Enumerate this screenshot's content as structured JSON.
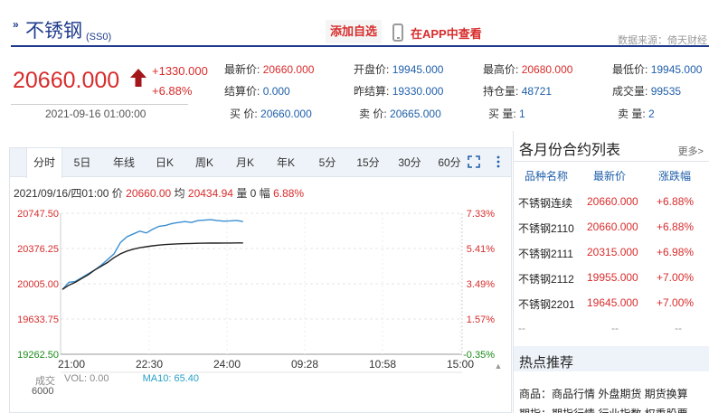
{
  "header": {
    "mark": "»",
    "name": "不锈钢",
    "code": "(SS0)",
    "add_favorite": "添加自选",
    "app_view": "在APP中查看",
    "data_source": "数据来源：倚天财经"
  },
  "quote": {
    "price": "20660.000",
    "change_abs": "+1330.000",
    "change_pct": "+6.88%",
    "time": "2021-09-16 01:00:00",
    "fields": [
      {
        "label": "最新价:",
        "value": "20660.000"
      },
      {
        "label": "开盘价:",
        "value": "19945.000"
      },
      {
        "label": "最高价:",
        "value": "20680.000"
      },
      {
        "label": "最低价:",
        "value": "19945.000"
      },
      {
        "label": "结算价:",
        "value": "0.000"
      },
      {
        "label": "昨结算:",
        "value": "19330.000"
      },
      {
        "label": "持仓量:",
        "value": "48721"
      },
      {
        "label": "成交量:",
        "value": "99535"
      },
      {
        "label": "买  价:",
        "value": "20660.000"
      },
      {
        "label": "卖  价:",
        "value": "20665.000"
      },
      {
        "label": "买  量:",
        "value": "1"
      },
      {
        "label": "卖  量:",
        "value": "2"
      }
    ]
  },
  "tabs": [
    "分时",
    "5日",
    "年线",
    "日K",
    "周K",
    "月K",
    "年K",
    "5分",
    "15分",
    "30分",
    "60分"
  ],
  "info_line": {
    "date": "2021/09/16/四01:00",
    "price_label": "价",
    "price": "20660.00",
    "avg_label": "均",
    "avg": "20434.94",
    "vol_label": "量",
    "vol": "0",
    "amp_label": "幅",
    "amp": "6.88%"
  },
  "chart_data": {
    "type": "line",
    "y_left_ticks": [
      "20747.50",
      "20376.25",
      "20005.00",
      "19633.75",
      "19262.50"
    ],
    "y_right_ticks": [
      "7.33%",
      "5.41%",
      "3.49%",
      "1.57%",
      "-0.35%"
    ],
    "x_ticks": [
      "21:00",
      "22:30",
      "24:00",
      "09:28",
      "10:58",
      "15:00"
    ],
    "ylim": [
      19262.5,
      20747.5
    ],
    "series": [
      {
        "color": "#3a8fd0",
        "values": [
          19945,
          20020,
          20030,
          20070,
          20110,
          20150,
          20200,
          20260,
          20320,
          20440,
          20500,
          20530,
          20560,
          20540,
          20580,
          20610,
          20620,
          20640,
          20650,
          20660,
          20650,
          20670,
          20675,
          20680,
          20670,
          20665,
          20668,
          20672,
          20660
        ]
      },
      {
        "color": "#222222",
        "values": [
          19945,
          19990,
          20020,
          20060,
          20100,
          20150,
          20190,
          20230,
          20280,
          20320,
          20350,
          20370,
          20385,
          20395,
          20405,
          20412,
          20418,
          20422,
          20426,
          20428,
          20430,
          20431,
          20432,
          20433,
          20433,
          20434,
          20434,
          20435,
          20435
        ]
      }
    ],
    "progress_fraction": 0.45,
    "volume": {
      "label": "成交",
      "vol_text": "VOL: 0.00",
      "ma10_text": "MA10: 65.40",
      "tick": "6000"
    }
  },
  "side": {
    "title": "各月份合约列表",
    "more": "更多>",
    "headers": [
      "品种名称",
      "最新价",
      "涨跌幅"
    ],
    "rows": [
      {
        "name": "不锈钢连续",
        "price": "20660.000",
        "chg": "+6.88%"
      },
      {
        "name": "不锈钢2110",
        "price": "20660.000",
        "chg": "+6.88%"
      },
      {
        "name": "不锈钢2111",
        "price": "20315.000",
        "chg": "+6.98%"
      },
      {
        "name": "不锈钢2112",
        "price": "19955.000",
        "chg": "+7.00%"
      },
      {
        "name": "不锈钢2201",
        "price": "19645.000",
        "chg": "+7.00%"
      },
      {
        "name": "--",
        "price": "--",
        "chg": "--"
      }
    ],
    "hot_title": "热点推荐",
    "hot_line1": "商品：商品行情 外盘期货 期货换算",
    "hot_line2": "期指：期指行情 行业指数 权重股票"
  },
  "colors": {
    "up": "#d82c2c",
    "brand": "#1f3b8d",
    "price_line": "#3a8fd0",
    "avg_line": "#222222"
  }
}
